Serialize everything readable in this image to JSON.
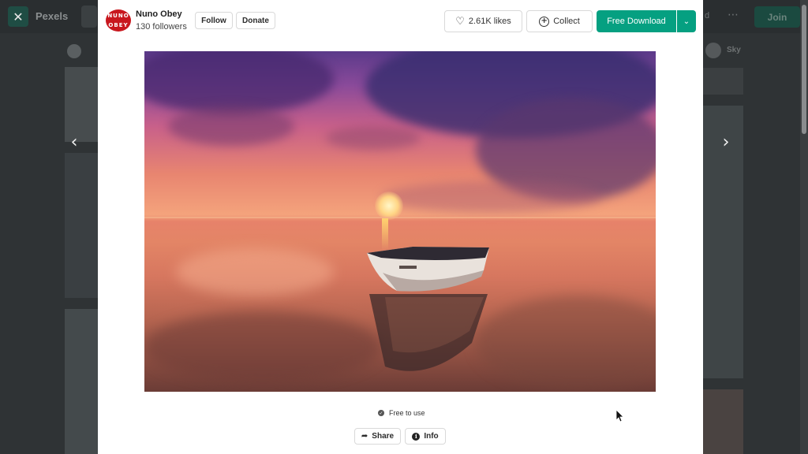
{
  "background_page": {
    "brand": "Pexels",
    "join_label": "Join",
    "close_icon": "close-icon",
    "nav_dots_icon": "more-icon",
    "partial_nav_text": "d",
    "sky_label": "Sky"
  },
  "viewer": {
    "prev_icon": "chevron-left-icon",
    "next_icon": "chevron-right-icon"
  },
  "author": {
    "avatar_text": [
      "NUNO",
      "OBEY"
    ],
    "name": "Nuno Obey",
    "followers": "130 followers"
  },
  "actions": {
    "follow_label": "Follow",
    "donate_label": "Donate",
    "likes_label": "2.61K likes",
    "collect_label": "Collect",
    "download_label": "Free Download",
    "download_caret_icon": "chevron-down-icon"
  },
  "photo": {
    "subject": "sunset boat on calm sea"
  },
  "footer": {
    "license_label": "Free to use",
    "share_label": "Share",
    "info_label": "Info"
  },
  "colors": {
    "accent": "#05a081",
    "modal_bg": "#ffffff",
    "overlay_bg": "#2f3335"
  }
}
